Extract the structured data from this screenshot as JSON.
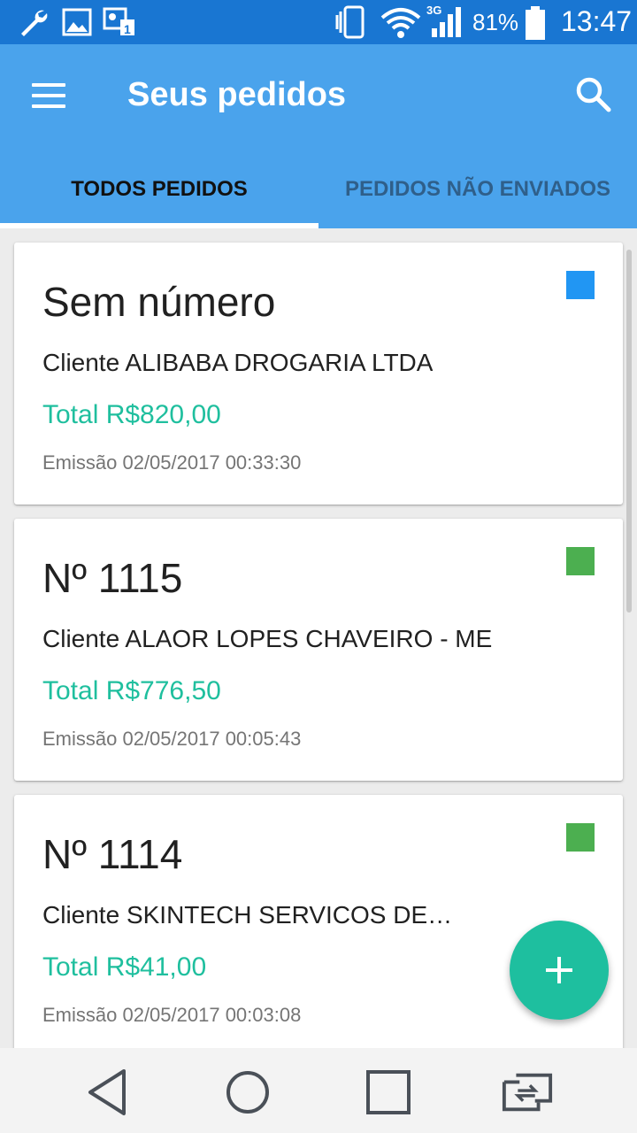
{
  "status_bar": {
    "battery_percent": "81%",
    "time": "13:47",
    "network_type": "3G",
    "icons": [
      "wrench-icon",
      "image-icon",
      "sim-lock-icon",
      "vibrate-icon",
      "wifi-icon",
      "signal-icon",
      "battery-icon"
    ]
  },
  "app_bar": {
    "title": "Seus pedidos",
    "menu_icon": "hamburger-menu-icon",
    "search_icon": "search-icon"
  },
  "tabs": [
    {
      "label": "TODOS PEDIDOS",
      "selected": true
    },
    {
      "label": "PEDIDOS NÃO ENVIADOS",
      "selected": false
    }
  ],
  "orders": [
    {
      "number": "Sem número",
      "client": "Cliente ALIBABA DROGARIA LTDA",
      "total": "Total R$820,00",
      "emission": "Emissão 02/05/2017 00:33:30",
      "status_color": "#2196f3"
    },
    {
      "number": "Nº 1115",
      "client": "Cliente ALAOR LOPES CHAVEIRO - ME",
      "total": "Total R$776,50",
      "emission": "Emissão 02/05/2017 00:05:43",
      "status_color": "#4caf50"
    },
    {
      "number": "Nº 1114",
      "client": "Cliente SKINTECH SERVICOS DE…",
      "total": "Total R$41,00",
      "emission": "Emissão 02/05/2017 00:03:08",
      "status_color": "#4caf50"
    }
  ],
  "fab": {
    "icon": "plus-icon"
  },
  "nav_bar": {
    "icons": [
      "back-icon",
      "home-icon",
      "recents-icon",
      "dual-window-icon"
    ]
  },
  "colors": {
    "status_bar": "#1976d2",
    "app_bar": "#4aa3ec",
    "accent": "#1ebf9f",
    "total_text": "#1fbf9e"
  }
}
